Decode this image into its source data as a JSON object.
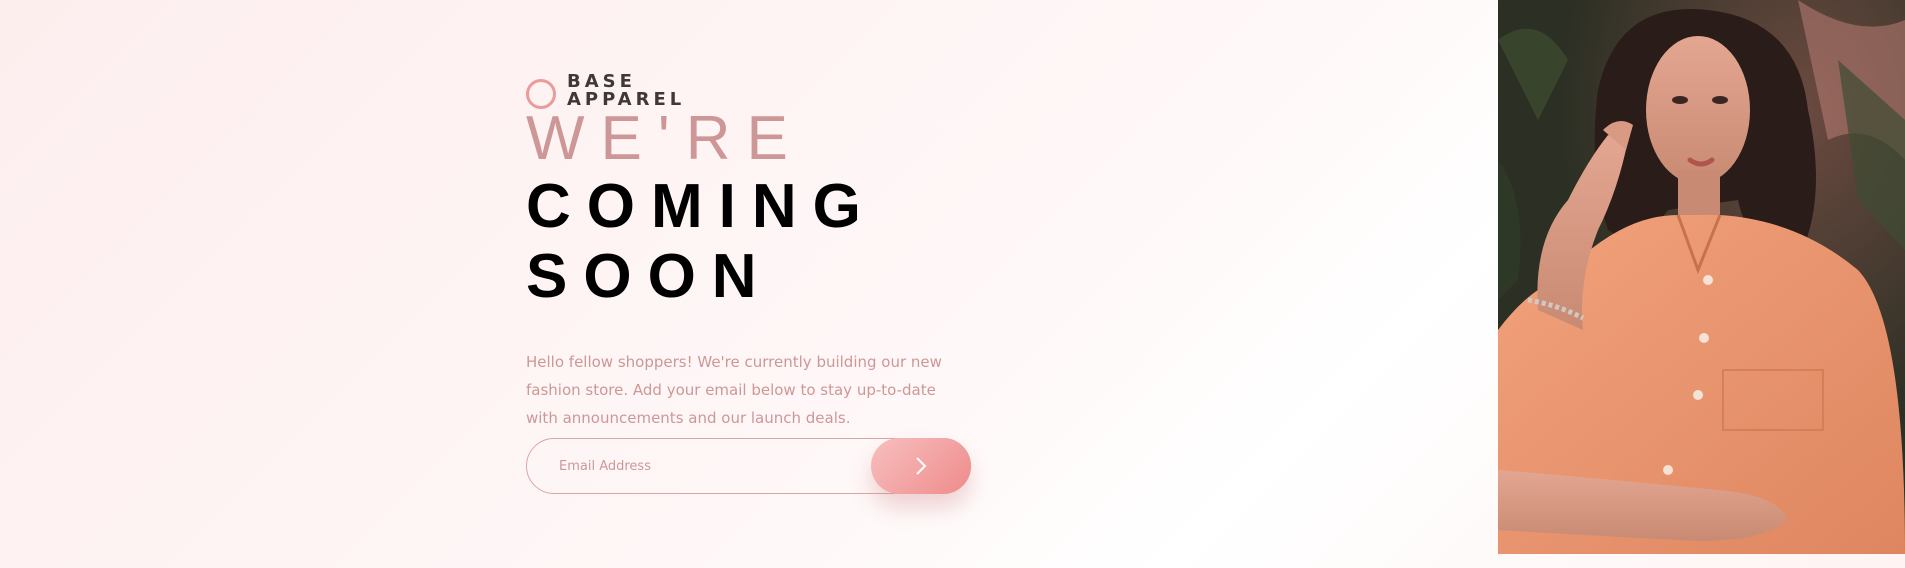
{
  "brand": {
    "line1": "BASE",
    "line2": "APPAREL"
  },
  "headline": {
    "light": "WE'RE",
    "strong_line1": "COMING",
    "strong_line2": "SOON"
  },
  "description": "Hello fellow shoppers! We're currently building our new fashion store. Add your email below to stay up-to-date with announcements and our launch deals.",
  "form": {
    "email_placeholder": "Email Address",
    "submit_icon": "chevron-right-icon"
  },
  "hero_image": {
    "subject": "woman-in-peach-shirt-photo"
  },
  "colors": {
    "accent": "#ce9797",
    "button_gradient_start": "#f8bfbf",
    "button_gradient_end": "#ee8b8b",
    "logo_text": "#3e3838",
    "headline_dark": "#000000"
  }
}
